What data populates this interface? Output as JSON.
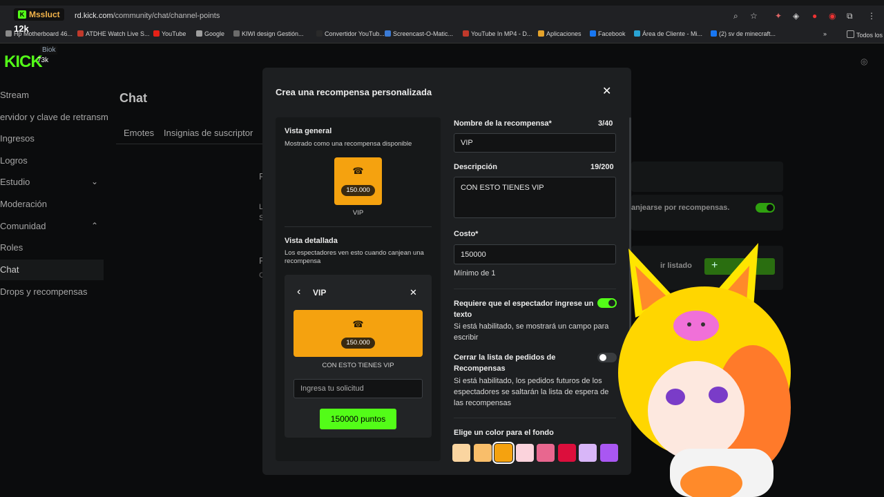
{
  "browser": {
    "url_prefix": "rd.kick.com",
    "url_path": "/community/chat/channel-points",
    "bookmarks": [
      {
        "label": "Hp Motherboard 46...",
        "color": "#8a8a8a"
      },
      {
        "label": "ATDHE Watch Live S...",
        "color": "#c0392b"
      },
      {
        "label": "YouTube",
        "color": "#e62117"
      },
      {
        "label": "Google",
        "color": "#9e9e9e"
      },
      {
        "label": "KIWI design Gestión...",
        "color": "#6b6b6b"
      },
      {
        "label": "Convertidor YouTub...",
        "color": "#2a2a2a"
      },
      {
        "label": "Screencast-O-Matic...",
        "color": "#3b7bd6"
      },
      {
        "label": "YouTube In MP4 - D...",
        "color": "#c0392b"
      },
      {
        "label": "Aplicaciones",
        "color": "#e5a32b"
      },
      {
        "label": "Facebook",
        "color": "#1877f2"
      },
      {
        "label": "Área de Cliente - Mi...",
        "color": "#29a3d4"
      },
      {
        "label": "(2) sv de minecraft...",
        "color": "#1877f2"
      }
    ],
    "other_bookmarks": "Todos los"
  },
  "stream": {
    "streamer_name": "Mssluct",
    "viewers": "12k",
    "channel_tag": "Biok",
    "channel_count": "73k"
  },
  "kick": {
    "logo": "KICK",
    "sidebar": [
      "Stream",
      "ervidor y clave de retransm",
      "Ingresos",
      "Logros",
      "Estudio",
      "Moderación",
      "Comunidad",
      "Roles",
      "Chat",
      "Drops y recompensas"
    ],
    "page_title": "Chat",
    "tabs": [
      "Emotes",
      "Insignias de suscriptor"
    ],
    "bg_texts": {
      "right1": "anjearse por recompensas.",
      "right2": "ir listado",
      "letterP1": "P",
      "letterL": "L",
      "letterS": "S",
      "letterP2": "P",
      "letterC": "C"
    }
  },
  "modal": {
    "title": "Crea una recompensa personalizada",
    "overview_title": "Vista general",
    "overview_sub": "Mostrado como una recompensa disponible",
    "cost_pill": "150.000",
    "reward_name": "VIP",
    "detailed_title": "Vista detallada",
    "detailed_sub": "Los espectadores ven esto cuando canjean una recompensa",
    "detail_header": "VIP",
    "detail_description": "CON ESTO TIENES VIP",
    "request_placeholder": "Ingresa tu solicitud",
    "points_button": "150000 puntos",
    "name_label": "Nombre de la recompensa*",
    "name_count": "3/40",
    "name_value": "VIP",
    "desc_label": "Descripción",
    "desc_count": "19/200",
    "desc_value": "CON ESTO TIENES VIP",
    "cost_label": "Costo*",
    "cost_value": "150000",
    "cost_min": "Mínimo de 1",
    "require_label": "Requiere que el espectador ingrese un texto",
    "require_help": "Si está habilitado, se mostrará un campo para escribir",
    "require_on": true,
    "close_label": "Cerrar la lista de pedidos de Recompensas",
    "close_help": "Si está habilitado, los pedidos futuros de los espectadores se saltarán la lista de espera de las recompensas",
    "close_on": false,
    "color_label": "Elige un color para el fondo",
    "colors": [
      "#fad5a0",
      "#f9be6a",
      "#f5a20f",
      "#fbd3dc",
      "#e8678f",
      "#dc0e3c",
      "#d8b6f8",
      "#a957f2"
    ],
    "selected_color": "#f5a20f"
  }
}
